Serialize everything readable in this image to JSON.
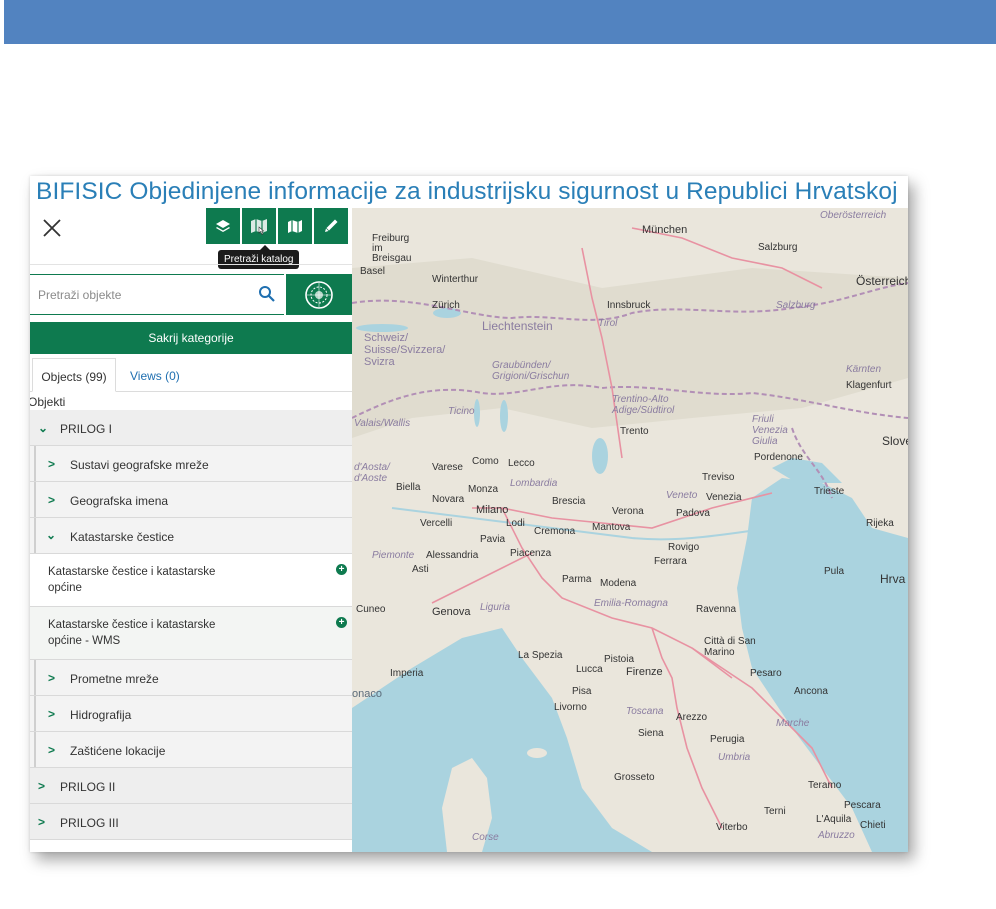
{
  "app": {
    "title": "BIFISIC Objedinjene informacije za industrijsku sigurnost u Republici Hrvatskoj"
  },
  "toolbar": {
    "buttons": [
      {
        "icon": "layers-icon"
      },
      {
        "icon": "catalog-map-icon"
      },
      {
        "icon": "book-map-icon"
      },
      {
        "icon": "pen-icon"
      }
    ],
    "tooltip": "Pretraži katalog"
  },
  "search": {
    "placeholder": "Pretraži objekte"
  },
  "hide_categories_label": "Sakrij kategorije",
  "tabs": [
    {
      "label": "Objects (99)",
      "active": true
    },
    {
      "label": "Views (0)",
      "active": false
    }
  ],
  "section_label": "Objekti",
  "tree": {
    "prilog1": "PRILOG I",
    "children": [
      "Sustavi geografske mreže",
      "Geografska imena",
      "Katastarske čestice",
      "Prometne mreže",
      "Hidrografija",
      "Zaštićene lokacije"
    ],
    "leaves": [
      "Katastarske čestice i katastarske općine",
      "Katastarske čestice i katastarske općine - WMS"
    ],
    "prilog2": "PRILOG II",
    "prilog3": "PRILOG III"
  },
  "map": {
    "labels": {
      "munchen": "München",
      "oberosterreich": "Oberösterreich",
      "freiburg": "Freiburg im Breisgau",
      "salzburg_city": "Salzburg",
      "osterreich": "Österreich",
      "basel": "Basel",
      "winterthur": "Winterthur",
      "zurich": "Zürich",
      "innsbruck": "Innsbruck",
      "salzburg_region": "Salzburg",
      "liechtenstein": "Liechtenstein",
      "tirol": "Tirol",
      "schweiz": "Schweiz/ Suisse/Svizzera/ Svizra",
      "graubunden": "Graubünden/ Grigioni/Grischun",
      "karnten": "Kärnten",
      "klagenfurt": "Klagenfurt",
      "ticino": "Ticino",
      "trentino": "Trentino-Alto Adige/Südtirol",
      "friuli": "Friuli Venezia Giulia",
      "valais": "Valais/Wallis",
      "trento": "Trento",
      "slove": "Slove",
      "aosta": "d'Aosta/ d'Aoste",
      "varese": "Varese",
      "como": "Como",
      "lecco": "Lecco",
      "pordenone": "Pordenone",
      "treviso": "Treviso",
      "biella": "Biella",
      "monza": "Monza",
      "lombardia": "Lombardia",
      "veneto": "Veneto",
      "venezia": "Venezia",
      "trieste": "Trieste",
      "novara": "Novara",
      "brescia": "Brescia",
      "verona": "Verona",
      "padova": "Padova",
      "milano": "Milano",
      "vercelli": "Vercelli",
      "lodi": "Lodi",
      "rijeka": "Rijeka",
      "pavia": "Pavia",
      "cremona": "Cremona",
      "mantova": "Mantova",
      "piemonte": "Piemonte",
      "alessandria": "Alessandria",
      "piacenza": "Piacenza",
      "rovigo": "Rovigo",
      "asti": "Asti",
      "ferrara": "Ferrara",
      "pula": "Pula",
      "hrva": "Hrva",
      "parma": "Parma",
      "modena": "Modena",
      "cuneo": "Cuneo",
      "genova": "Genova",
      "liguria": "Liguria",
      "emilia": "Emilia-Romagna",
      "ravenna": "Ravenna",
      "la_spezia": "La Spezia",
      "citta_san_marino": "Città di San Marino",
      "pistoia": "Pistoia",
      "monaco": "onaco",
      "imperia": "Imperia",
      "lucca": "Lucca",
      "firenze": "Firenze",
      "pesaro": "Pesaro",
      "ancona": "Ancona",
      "pisa": "Pisa",
      "livorno": "Livorno",
      "toscana": "Toscana",
      "arezzo": "Arezzo",
      "marche": "Marche",
      "siena": "Siena",
      "perugia": "Perugia",
      "umbria": "Umbria",
      "grosseto": "Grosseto",
      "teramo": "Teramo",
      "pescara": "Pescara",
      "terni": "Terni",
      "laquila": "L'Aquila",
      "chieti": "Chieti",
      "viterbo": "Viterbo",
      "abruzzo": "Abruzzo",
      "corse": "Corse"
    }
  },
  "colors": {
    "header_bar": "#5283c0",
    "accent_green": "#0e7a4f",
    "title_blue": "#2a7fb7",
    "sea": "#aad3df",
    "land": "#eae6dc"
  }
}
